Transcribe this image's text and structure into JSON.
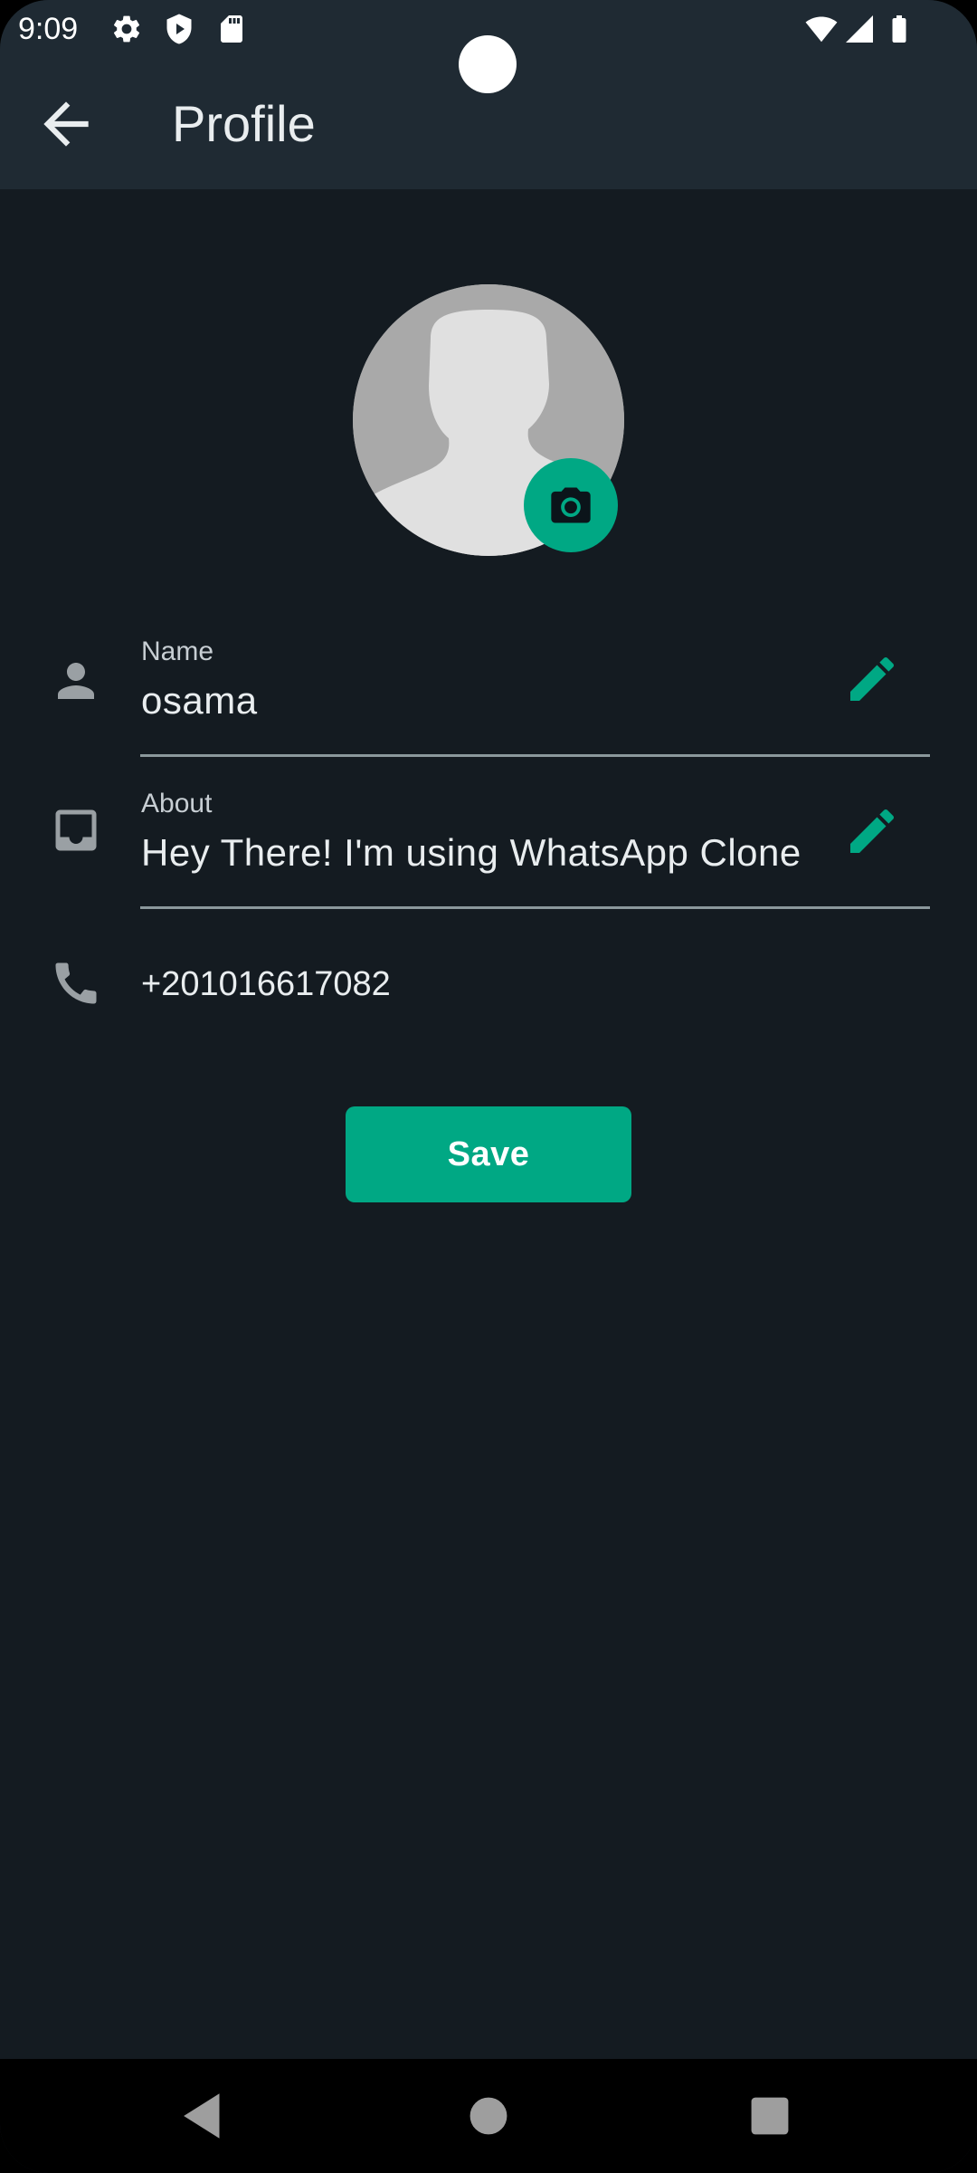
{
  "status_bar": {
    "time": "9:09",
    "left_icons": [
      "gear-icon",
      "shield-play-icon",
      "sd-card-icon"
    ],
    "right_icons": [
      "wifi-icon",
      "signal-icon",
      "battery-icon"
    ]
  },
  "app_bar": {
    "back_icon": "arrow-back-icon",
    "title": "Profile"
  },
  "profile": {
    "avatar_icon": "default-avatar",
    "camera_icon": "camera-icon",
    "name_label": "Name",
    "name_value": "osama",
    "about_label": "About",
    "about_value": "Hey There! I'm using WhatsApp Clone",
    "phone_value": "+201016617082",
    "save_label": "Save"
  },
  "colors": {
    "background": "#141b21",
    "header": "#1f2a33",
    "accent": "#00a884",
    "text_primary": "#e9edef",
    "icon_gray": "#9aa0a4"
  },
  "nav_bar": {
    "icons": [
      "nav-back-icon",
      "nav-home-icon",
      "nav-recents-icon"
    ]
  }
}
